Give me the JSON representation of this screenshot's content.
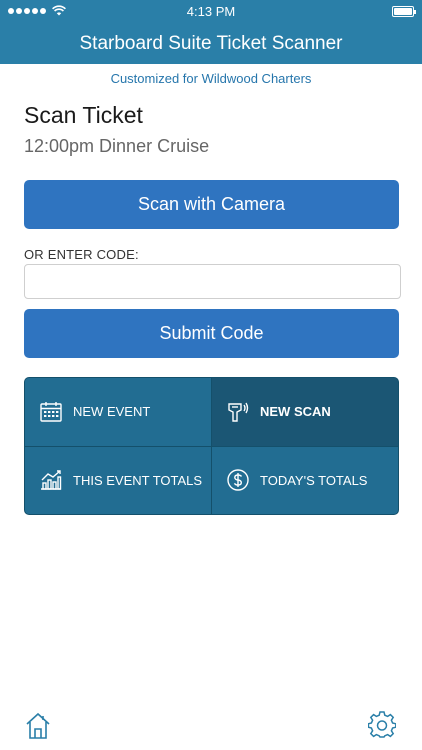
{
  "status_bar": {
    "time": "4:13 PM"
  },
  "nav": {
    "title": "Starboard Suite Ticket Scanner"
  },
  "subheader": "Customized for Wildwood Charters",
  "page": {
    "title": "Scan Ticket",
    "event": "12:00pm Dinner Cruise"
  },
  "scan_button": "Scan with Camera",
  "code": {
    "label": "OR ENTER CODE:",
    "value": "",
    "placeholder": ""
  },
  "submit_button": "Submit Code",
  "tiles": [
    {
      "label": "NEW EVENT",
      "icon": "calendar-icon",
      "active": false
    },
    {
      "label": "NEW SCAN",
      "icon": "scanner-icon",
      "active": true
    },
    {
      "label": "THIS EVENT TOTALS",
      "icon": "chart-icon",
      "active": false
    },
    {
      "label": "TODAY'S TOTALS",
      "icon": "dollar-icon",
      "active": false
    }
  ],
  "footer": {
    "left_icon": "home-icon",
    "right_icon": "gear-icon"
  },
  "colors": {
    "header": "#2a7fa8",
    "button": "#2f74c0",
    "tile": "#226d92",
    "tile_active": "#1b5674",
    "link": "#2676ac"
  }
}
